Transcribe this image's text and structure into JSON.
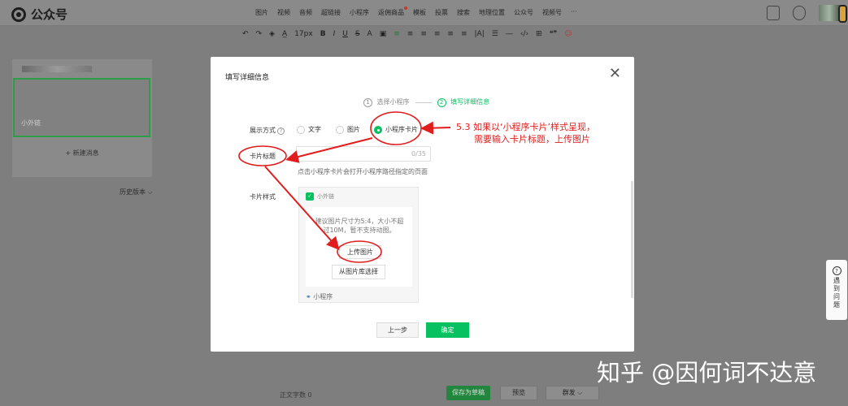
{
  "header": {
    "app_title": "公众号",
    "menu": [
      "图片",
      "视频",
      "音频",
      "超链接",
      "小程序",
      "返佣商品",
      "模板",
      "投票",
      "搜索",
      "地理位置",
      "公众号",
      "视频号",
      "···"
    ],
    "toolbar": [
      "↶",
      "↷",
      "◈",
      "A̲",
      "17px",
      "B",
      "I",
      "U",
      "S",
      "A",
      "▣",
      "≡",
      "≡",
      "≡",
      "≡",
      "≡",
      "≡",
      "|A|",
      "☰",
      "―",
      "‹/›",
      "⊞",
      "❝❞",
      "☺"
    ]
  },
  "left_panel": {
    "card_label": "小外链",
    "new_message": "+ 新建消息",
    "history": "历史版本 ⌵"
  },
  "dialog": {
    "title": "填写详细信息",
    "close": "✕",
    "steps": [
      {
        "num": "1",
        "label": "选择小程序"
      },
      {
        "num": "2",
        "label": "填写详细信息"
      }
    ],
    "display_label": "展示方式",
    "display_options": [
      "文字",
      "图片",
      "小程序卡片"
    ],
    "selected_option": "小程序卡片",
    "card_title_label": "卡片标题",
    "card_title_counter": "0/35",
    "hint": "点击小程序卡片会打开小程序路径指定的页面",
    "card_style_label": "卡片样式",
    "preview": {
      "app_name": "小外链",
      "tip": "建议图片尺寸为5:4，大小不超过10M，暂不支持动图。",
      "upload_button": "上传图片",
      "library_button": "从图片库选择",
      "footer": "小程序"
    },
    "prev_button": "上一步",
    "ok_button": "确定"
  },
  "annotation": {
    "line1": "5.3  如果以‘小程序卡片’样式呈现，",
    "line2": "需要输入卡片标题，上传图片"
  },
  "bottom": {
    "word_count": "正文字数 0",
    "save_draft": "保存为草稿",
    "preview": "预览",
    "publish": "群发 ⌵"
  },
  "help": {
    "q": "?",
    "text": [
      "遇",
      "到",
      "问",
      "题"
    ]
  },
  "watermark": "知乎 @因何词不达意",
  "colors": {
    "accent": "#07c160",
    "annotation": "#e11d1d",
    "overlay": "#7e7e7e"
  }
}
